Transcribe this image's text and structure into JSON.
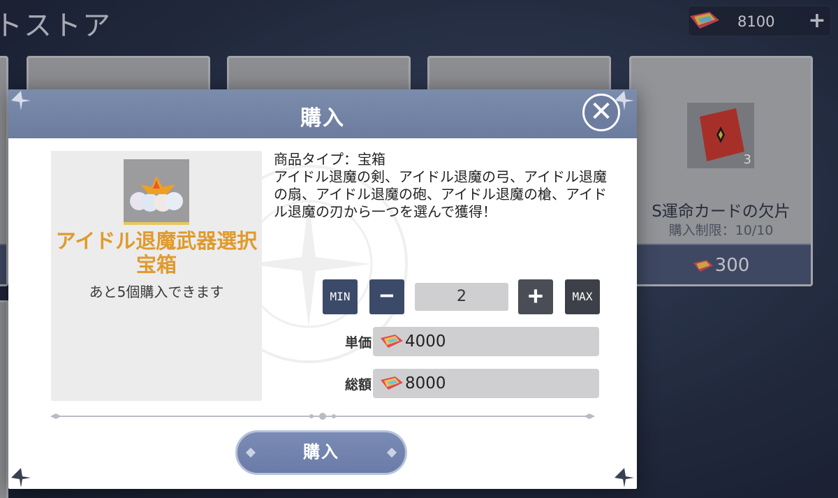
{
  "store": {
    "title": "トストア",
    "currency_amount": "8100",
    "card": {
      "name": "S運命カードの欠片",
      "limit": "購入制限：10/10",
      "price": "300",
      "badge_count": "3"
    }
  },
  "modal": {
    "title": "購入",
    "item_name": "アイドル退魔武器選択宝箱",
    "remaining": "あと5個購入できます",
    "description": "商品タイプ：宝箱\nアイドル退魔の剣、アイドル退魔の弓、アイドル退魔の扇、アイドル退魔の砲、アイドル退魔の槍、アイドル退魔の刃から一つを選んで獲得！",
    "quantity": {
      "min_label": "MIN",
      "max_label": "MAX",
      "value": "2"
    },
    "unit_price_label": "単価",
    "unit_price": "4000",
    "total_label": "総額",
    "total_price": "8000",
    "buy_label": "購入"
  },
  "colors": {
    "header": "#7384a6",
    "item_name": "#e09a2c",
    "button": "#6f80aa"
  },
  "icons": [
    "gem-ticket-icon",
    "plus-icon",
    "close-icon",
    "minus-icon",
    "treasure-chest-icon",
    "fate-card-icon"
  ]
}
